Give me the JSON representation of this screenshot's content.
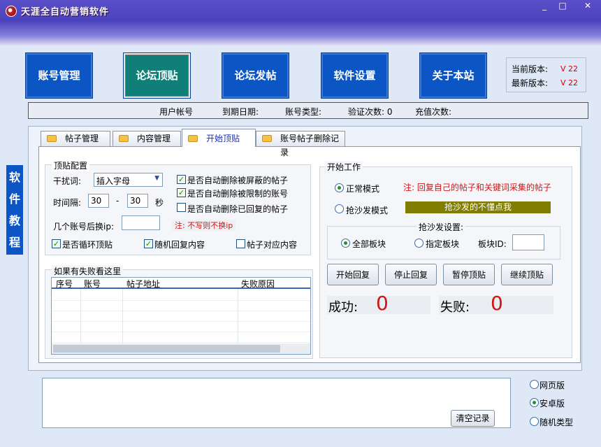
{
  "window": {
    "title": "天涯全自动营销软件",
    "min": "_",
    "max": "□",
    "close": "✕"
  },
  "nav": [
    {
      "label": "账号管理"
    },
    {
      "label": "论坛顶贴"
    },
    {
      "label": "论坛发帖"
    },
    {
      "label": "软件设置"
    },
    {
      "label": "关于本站"
    }
  ],
  "version": {
    "current_label": "当前版本:",
    "current_value": "V 22",
    "latest_label": "最新版本:",
    "latest_value": "V 22"
  },
  "info": {
    "user": "用户帐号",
    "expire": "到期日期:",
    "type": "账号类型:",
    "verify": "验证次数: 0",
    "recharge": "充值次数:"
  },
  "sidebar": {
    "label": [
      "软",
      "件",
      "教",
      "程"
    ]
  },
  "tabs": [
    {
      "label": "帖子管理"
    },
    {
      "label": "内容管理"
    },
    {
      "label": "开始顶贴"
    },
    {
      "label": "账号帖子删除记录"
    }
  ],
  "config": {
    "title": "顶贴配置",
    "interfere_label": "干扰词:",
    "interfere_value": "插入字母",
    "interval_label": "时间隔:",
    "interval_from": "30",
    "interval_dash": "-",
    "interval_to": "30",
    "interval_unit": "秒",
    "ip_label": "几个账号后换ip:",
    "ip_value": "",
    "ip_note": "注: 不写则不换ip",
    "checks": [
      {
        "label": "是否自动删除被屏蔽的帖子",
        "checked": true
      },
      {
        "label": "是否自动删除被限制的账号",
        "checked": true
      },
      {
        "label": "是否自动删除已回复的帖子",
        "checked": false
      },
      {
        "label": "是否循环顶贴",
        "checked": true
      },
      {
        "label": "随机回复内容",
        "checked": true
      },
      {
        "label": "帖子对应内容",
        "checked": false
      }
    ]
  },
  "failures": {
    "title": "如果有失败看这里",
    "columns": [
      "序号",
      "账号",
      "帖子地址",
      "失败原因"
    ],
    "rows": []
  },
  "work": {
    "title": "开始工作",
    "mode_normal": "正常模式",
    "mode_note": "注: 回复自己的帖子和关键词采集的帖子",
    "mode_sofa": "抢沙发模式",
    "sofa_status": "抢沙发的不懂点我",
    "sofa_settings_label": "抢沙发设置:",
    "all_boards": "全部板块",
    "specific_board": "指定板块",
    "board_id_label": "板块ID:",
    "board_id_value": "",
    "buttons": [
      "开始回复",
      "停止回复",
      "暂停顶贴",
      "继续顶贴"
    ],
    "success_label": "成功:",
    "success_value": "0",
    "fail_label": "失败:",
    "fail_value": "0"
  },
  "bottom": {
    "clear_label": "清空记录",
    "options": [
      {
        "label": "网页版",
        "selected": false
      },
      {
        "label": "安卓版",
        "selected": true
      },
      {
        "label": "随机类型",
        "selected": false
      }
    ]
  },
  "colors": {
    "nav_blue": "#0b56c4",
    "nav_active": "#0f7f78",
    "accent_red": "#d01515",
    "olive": "#807d00"
  }
}
